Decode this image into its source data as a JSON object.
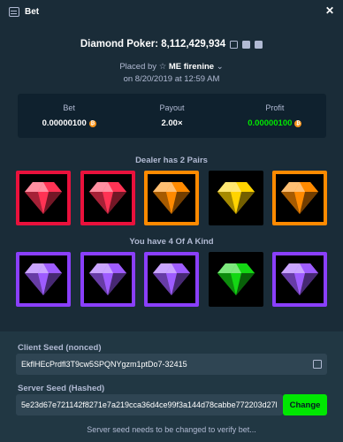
{
  "header": {
    "title": "Bet"
  },
  "bet": {
    "title": "Diamond Poker: 8,112,429,934",
    "placed_by_prefix": "Placed by",
    "username": "ME firenine",
    "date": "on 8/20/2019 at 12:59 AM"
  },
  "stats": [
    {
      "label": "Bet",
      "value": "0.00000100",
      "currency": "btc"
    },
    {
      "label": "Payout",
      "value": "2.00×"
    },
    {
      "label": "Profit",
      "value": "0.00000100",
      "currency": "btc"
    }
  ],
  "dealer": {
    "label": "Dealer has 2 Pairs",
    "gems": [
      {
        "color": "red",
        "highlight": "red"
      },
      {
        "color": "red",
        "highlight": "red"
      },
      {
        "color": "orange",
        "highlight": "orange"
      },
      {
        "color": "yellow",
        "highlight": "none"
      },
      {
        "color": "orange",
        "highlight": "orange"
      }
    ]
  },
  "player": {
    "label": "You have 4 Of A Kind",
    "gems": [
      {
        "color": "purple",
        "highlight": "purple"
      },
      {
        "color": "purple",
        "highlight": "purple"
      },
      {
        "color": "purple",
        "highlight": "purple"
      },
      {
        "color": "green",
        "highlight": "none"
      },
      {
        "color": "purple",
        "highlight": "purple"
      }
    ]
  },
  "seeds": {
    "client_label": "Client Seed (nonced)",
    "client_value": "EkflHEcPrdfl3T9cw5SPQNYgzm1ptDo7-32415",
    "server_label": "Server Seed (Hashed)",
    "server_value": "5e23d67e721142f8271e7a219cca36d4ce99f3a144d78cabbe772203d27l",
    "change_label": "Change",
    "note": "Server seed needs to be changed to verify bet..."
  },
  "colors": {
    "red": "#ff3354",
    "orange": "#ff8a00",
    "yellow": "#ffd400",
    "purple": "#9e5cff",
    "green": "#14d714",
    "accent_green": "#00e701"
  }
}
